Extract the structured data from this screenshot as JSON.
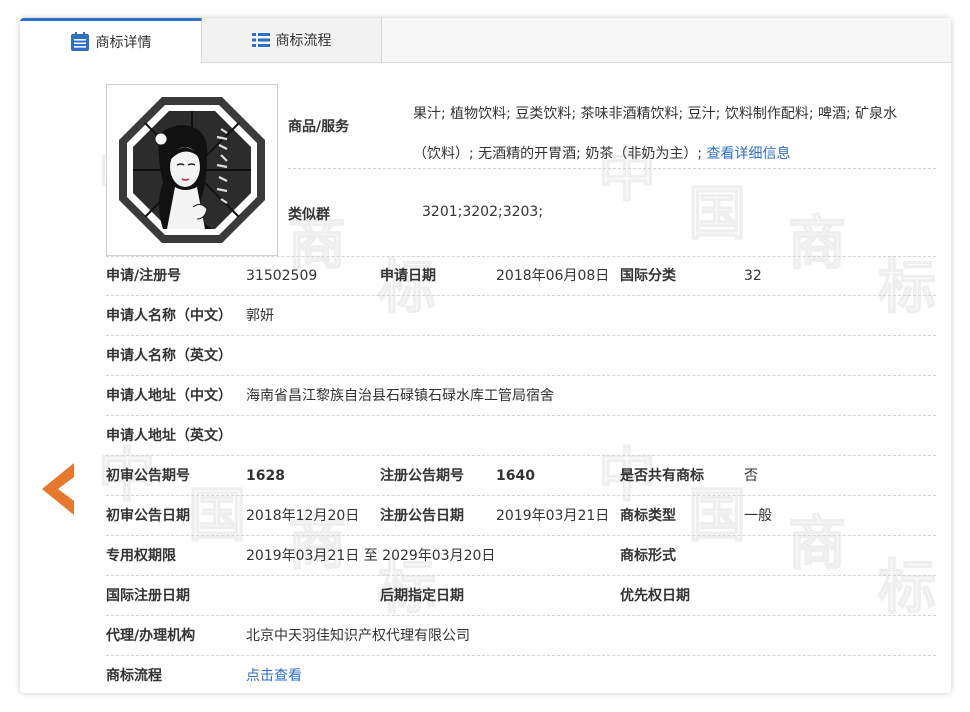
{
  "tabs": [
    {
      "label": "商标详情",
      "icon": "document-list-icon",
      "active": true
    },
    {
      "label": "商标流程",
      "icon": "list-icon",
      "active": false
    }
  ],
  "goods": {
    "label": "商品/服务",
    "text": "果汁; 植物饮料; 豆类饮料; 茶味非酒精饮料; 豆汁; 饮料制作配料; 啤酒; 矿泉水（饮料）; 无酒精的开胃酒; 奶茶（非奶为主）; ",
    "link": "查看详细信息"
  },
  "similar_group": {
    "label": "类似群",
    "value": "3201;3202;3203;"
  },
  "rows": [
    [
      {
        "label": "申请/注册号",
        "value": "31502509"
      },
      {
        "label": "申请日期",
        "value": "2018年06月08日"
      },
      {
        "label": "国际分类",
        "value": "32"
      }
    ],
    [
      {
        "label": "申请人名称（中文）",
        "value": "郭妍"
      }
    ],
    [
      {
        "label": "申请人名称（英文）",
        "value": ""
      }
    ],
    [
      {
        "label": "申请人地址（中文）",
        "value": "海南省昌江黎族自治县石碌镇石碌水库工管局宿舍"
      }
    ],
    [
      {
        "label": "申请人地址（英文）",
        "value": ""
      }
    ],
    [
      {
        "label": "初审公告期号",
        "value": "1628"
      },
      {
        "label": "注册公告期号",
        "value": "1640"
      },
      {
        "label": "是否共有商标",
        "value": "否"
      }
    ],
    [
      {
        "label": "初审公告日期",
        "value": "2018年12月20日"
      },
      {
        "label": "注册公告日期",
        "value": "2019年03月21日"
      },
      {
        "label": "商标类型",
        "value": "一般"
      }
    ],
    [
      {
        "label": "专用权期限",
        "value": "2019年03月21日 至 2029年03月20日"
      },
      {
        "label": "商标形式",
        "value": ""
      }
    ],
    [
      {
        "label": "国际注册日期",
        "value": ""
      },
      {
        "label": "后期指定日期",
        "value": ""
      },
      {
        "label": "优先权日期",
        "value": ""
      }
    ],
    [
      {
        "label": "代理/办理机构",
        "value": "北京中天羽佳知识产权代理有限公司"
      }
    ],
    [
      {
        "label": "商标流程",
        "value": "点击查看"
      }
    ]
  ],
  "watermark_chars": [
    "中",
    "国",
    "商",
    "标"
  ],
  "colors": {
    "accent": "#2d6fc6",
    "arrow": "#e8772e"
  }
}
